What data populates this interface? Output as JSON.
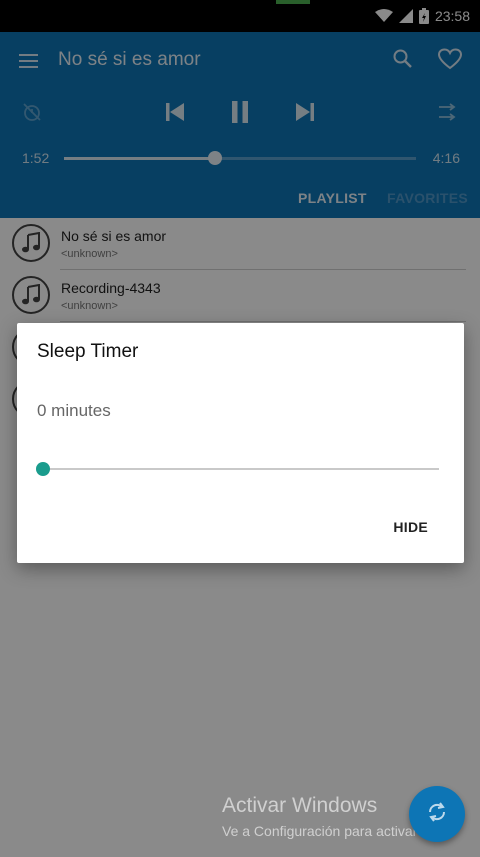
{
  "status_bar": {
    "time": "23:58",
    "icons": [
      "wifi-icon",
      "signal-icon",
      "battery-icon"
    ]
  },
  "player": {
    "song_title": "No sé si es amor",
    "elapsed": "1:52",
    "duration": "4:16",
    "progress": 0.428,
    "icons": [
      "menu-icon",
      "search-icon",
      "heart-icon",
      "sleep-timer-off-icon",
      "previous-icon",
      "pause-icon",
      "next-icon",
      "shuffle-icon"
    ]
  },
  "tabs": [
    {
      "label": "PLAYLIST",
      "active": true
    },
    {
      "label": "FAVORITES",
      "active": false
    }
  ],
  "playlist": [
    {
      "title": "No sé si es amor",
      "subtitle": "<unknown>"
    },
    {
      "title": "Recording-4343",
      "subtitle": "<unknown>"
    }
  ],
  "dialog": {
    "title": "Sleep Timer",
    "value_text": "0 minutes",
    "slider_value": 0,
    "hide_label": "HIDE"
  },
  "watermark": {
    "title": "Activar Windows",
    "subtitle": "Ve a Configuración para activar Wind"
  },
  "fab": {
    "icon": "repeat-icon"
  },
  "colors": {
    "primary": "#0d75b5",
    "accent": "#1a9c8d"
  }
}
